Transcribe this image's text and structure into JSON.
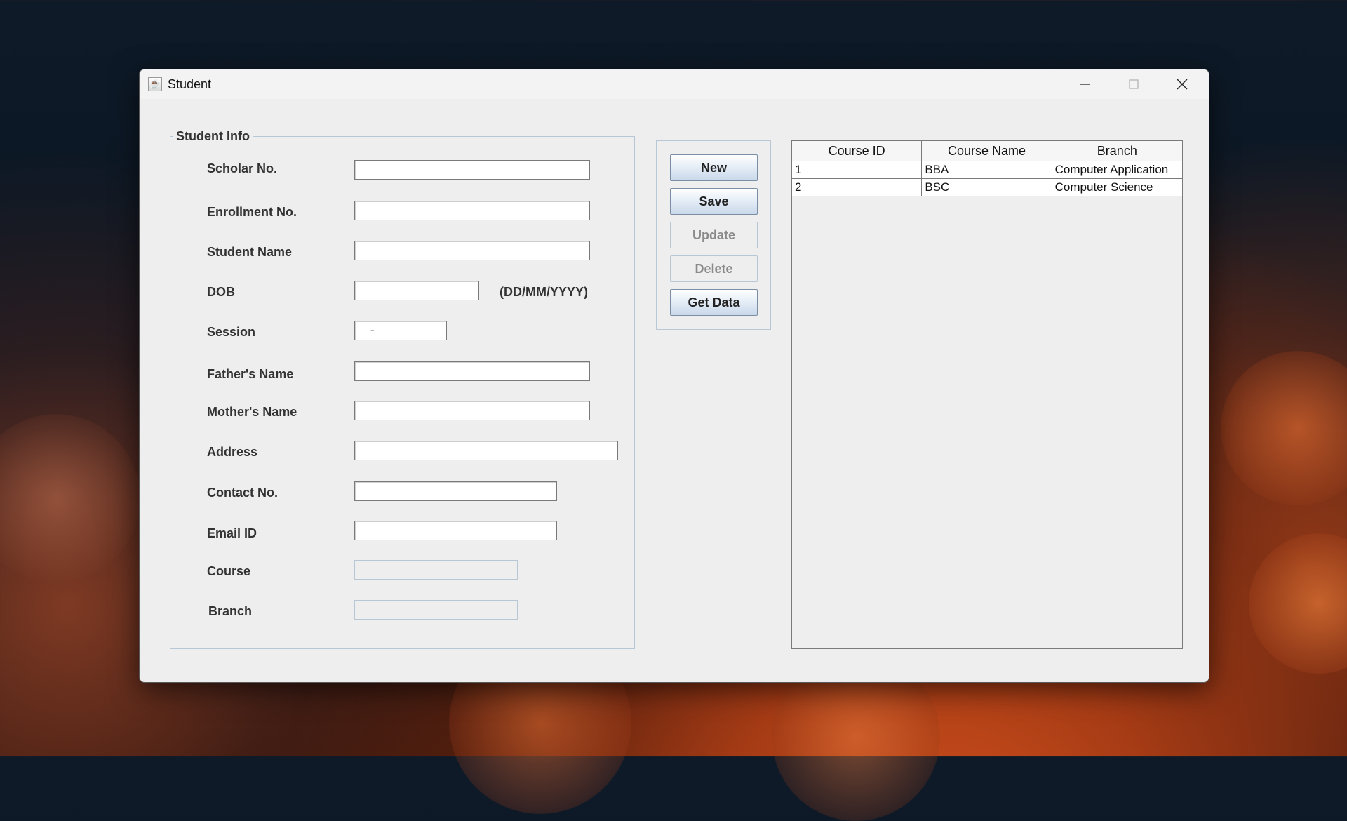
{
  "window": {
    "title": "Student",
    "icon": "java-icon"
  },
  "form": {
    "group_title": "Student Info",
    "fields": {
      "scholar_no": {
        "label": "Scholar No.",
        "value": ""
      },
      "enrollment_no": {
        "label": "Enrollment No.",
        "value": ""
      },
      "student_name": {
        "label": "Student Name",
        "value": ""
      },
      "dob": {
        "label": "DOB",
        "value": "",
        "hint": "(DD/MM/YYYY)"
      },
      "session": {
        "label": "Session",
        "value": "-"
      },
      "fathers_name": {
        "label": "Father's Name",
        "value": ""
      },
      "mothers_name": {
        "label": "Mother's Name",
        "value": ""
      },
      "address": {
        "label": "Address",
        "value": ""
      },
      "contact_no": {
        "label": "Contact No.",
        "value": ""
      },
      "email_id": {
        "label": "Email ID",
        "value": ""
      },
      "course": {
        "label": "Course",
        "value": ""
      },
      "branch": {
        "label": "Branch",
        "value": ""
      }
    }
  },
  "buttons": {
    "new": "New",
    "save": "Save",
    "update": "Update",
    "delete": "Delete",
    "get_data": "Get Data"
  },
  "table": {
    "columns": [
      "Course ID",
      "Course Name",
      "Branch"
    ],
    "rows": [
      [
        "1",
        "BBA",
        "Computer Application"
      ],
      [
        "2",
        "BSC",
        "Computer Science"
      ]
    ]
  }
}
